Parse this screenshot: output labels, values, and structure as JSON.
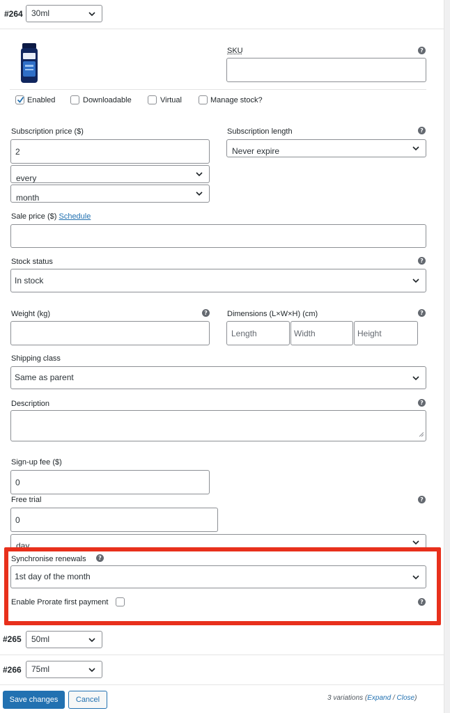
{
  "variations": [
    {
      "id": "#264",
      "size": "30ml"
    },
    {
      "id": "#265",
      "size": "50ml"
    },
    {
      "id": "#266",
      "size": "75ml"
    }
  ],
  "sku": {
    "label": "SKU",
    "value": ""
  },
  "checkboxes": {
    "enabled": {
      "label": "Enabled",
      "checked": true
    },
    "downloadable": {
      "label": "Downloadable",
      "checked": false
    },
    "virtual": {
      "label": "Virtual",
      "checked": false
    },
    "manage_stock": {
      "label": "Manage stock?",
      "checked": false
    }
  },
  "subscription_price": {
    "label": "Subscription price ($)",
    "value": "2",
    "interval": "every",
    "period": "month"
  },
  "subscription_length": {
    "label": "Subscription length",
    "value": "Never expire"
  },
  "sale_price": {
    "label": "Sale price ($)",
    "schedule_link": "Schedule",
    "value": ""
  },
  "stock_status": {
    "label": "Stock status",
    "value": "In stock"
  },
  "weight": {
    "label": "Weight (kg)",
    "value": ""
  },
  "dimensions": {
    "label": "Dimensions (L×W×H) (cm)",
    "length_placeholder": "Length",
    "width_placeholder": "Width",
    "height_placeholder": "Height"
  },
  "shipping_class": {
    "label": "Shipping class",
    "value": "Same as parent"
  },
  "description": {
    "label": "Description",
    "value": ""
  },
  "signup_fee": {
    "label": "Sign-up fee ($)",
    "value": "0"
  },
  "free_trial": {
    "label": "Free trial",
    "value": "0",
    "period": "day"
  },
  "synchronise": {
    "label": "Synchronise renewals",
    "value": "1st day of the month"
  },
  "prorate": {
    "label": "Enable Prorate first payment",
    "checked": false
  },
  "footer": {
    "save_label": "Save changes",
    "cancel_label": "Cancel",
    "count_text": "3 variations (",
    "expand": "Expand",
    "slash": " / ",
    "close": "Close",
    "close_paren": ")"
  },
  "colors": {
    "accent": "#2271b1",
    "highlight_border": "#e8301c",
    "text": "#1d2327",
    "border": "#8c8f94"
  },
  "icons": [
    "help-icon",
    "chevron-down-icon",
    "checkmark-icon",
    "product-image"
  ]
}
